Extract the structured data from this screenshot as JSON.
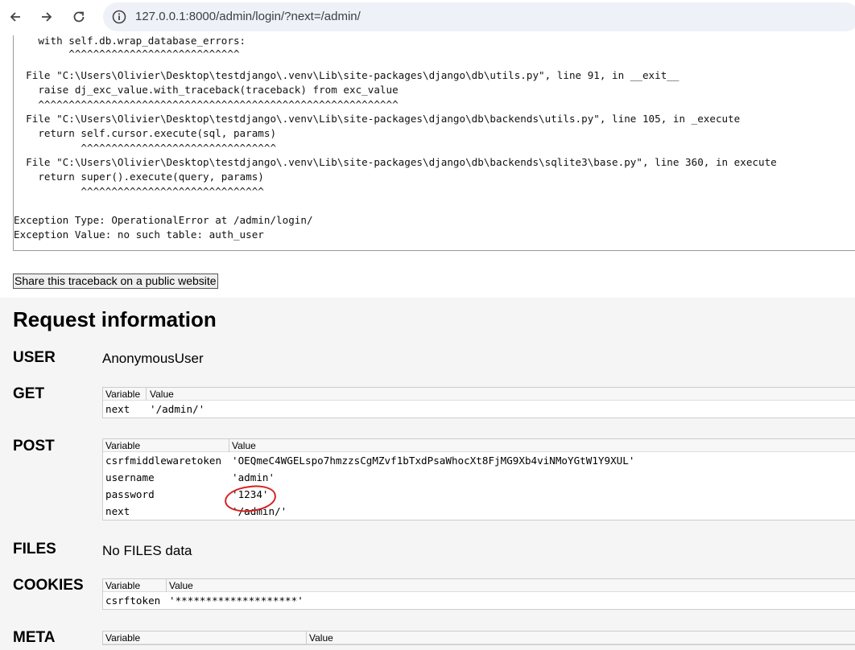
{
  "browser": {
    "url": "127.0.0.1:8000/admin/login/?next=/admin/"
  },
  "traceback": {
    "lines": [
      "    with self.db.wrap_database_errors:",
      "         ^^^^^^^^^^^^^^^^^^^^^^^^^^^^",
      "",
      "  File \"C:\\Users\\Olivier\\Desktop\\testdjango\\.venv\\Lib\\site-packages\\django\\db\\utils.py\", line 91, in __exit__",
      "    raise dj_exc_value.with_traceback(traceback) from exc_value",
      "    ^^^^^^^^^^^^^^^^^^^^^^^^^^^^^^^^^^^^^^^^^^^^^^^^^^^^^^^^^^^",
      "  File \"C:\\Users\\Olivier\\Desktop\\testdjango\\.venv\\Lib\\site-packages\\django\\db\\backends\\utils.py\", line 105, in _execute",
      "    return self.cursor.execute(sql, params)",
      "           ^^^^^^^^^^^^^^^^^^^^^^^^^^^^^^^^",
      "  File \"C:\\Users\\Olivier\\Desktop\\testdjango\\.venv\\Lib\\site-packages\\django\\db\\backends\\sqlite3\\base.py\", line 360, in execute",
      "    return super().execute(query, params)",
      "           ^^^^^^^^^^^^^^^^^^^^^^^^^^^^^^",
      "",
      "",
      "Exception Type: OperationalError at /admin/login/",
      "Exception Value: no such table: auth_user"
    ]
  },
  "share_button_label": "Share this traceback on a public website",
  "request": {
    "title": "Request information",
    "user": {
      "label": "USER",
      "value": "AnonymousUser"
    },
    "get": {
      "label": "GET",
      "headers": [
        "Variable",
        "Value"
      ],
      "rows": [
        {
          "variable": "next",
          "value": "'/admin/'"
        }
      ]
    },
    "post": {
      "label": "POST",
      "headers": [
        "Variable",
        "Value"
      ],
      "rows": [
        {
          "variable": "csrfmiddlewaretoken",
          "value": "'OEQmeC4WGELspo7hmzzsCgMZvf1bTxdPsaWhocXt8FjMG9Xb4viNMoYGtW1Y9XUL'"
        },
        {
          "variable": "username",
          "value": "'admin'"
        },
        {
          "variable": "password",
          "value": "'1234'"
        },
        {
          "variable": "next",
          "value": "'/admin/'"
        }
      ]
    },
    "files": {
      "label": "FILES",
      "value": "No FILES data"
    },
    "cookies": {
      "label": "COOKIES",
      "headers": [
        "Variable",
        "Value"
      ],
      "rows": [
        {
          "variable": "csrftoken",
          "value": "'********************'"
        }
      ]
    },
    "meta": {
      "label": "META",
      "headers": [
        "Variable",
        "Value"
      ]
    }
  },
  "annotation_color": "#d61f1f"
}
